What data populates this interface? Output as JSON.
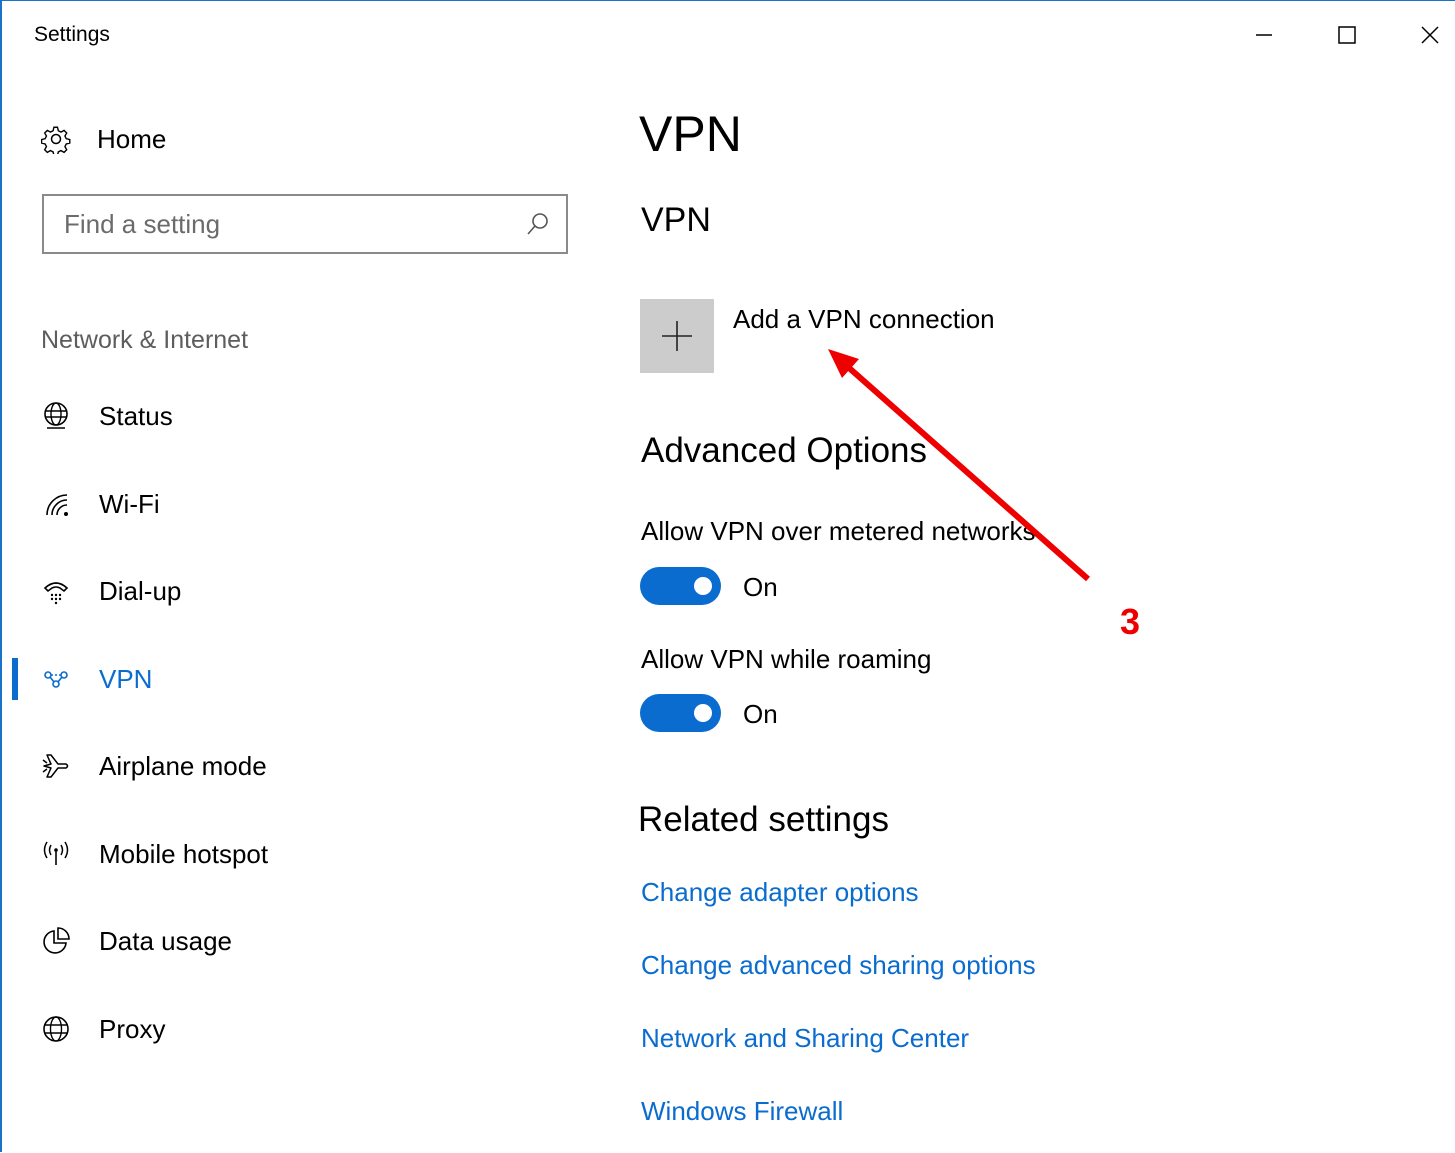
{
  "window": {
    "title": "Settings",
    "controls": [
      "minimize",
      "maximize",
      "close"
    ]
  },
  "sidebar": {
    "home_label": "Home",
    "search": {
      "placeholder": "Find a setting",
      "value": ""
    },
    "section_label": "Network & Internet",
    "items": [
      {
        "label": "Status",
        "icon": "globe-status-icon",
        "active": false
      },
      {
        "label": "Wi-Fi",
        "icon": "wifi-icon",
        "active": false
      },
      {
        "label": "Dial-up",
        "icon": "dialup-phone-icon",
        "active": false
      },
      {
        "label": "VPN",
        "icon": "vpn-icon",
        "active": true
      },
      {
        "label": "Airplane mode",
        "icon": "airplane-icon",
        "active": false
      },
      {
        "label": "Mobile hotspot",
        "icon": "hotspot-icon",
        "active": false
      },
      {
        "label": "Data usage",
        "icon": "pie-chart-icon",
        "active": false
      },
      {
        "label": "Proxy",
        "icon": "globe-icon",
        "active": false
      }
    ]
  },
  "main": {
    "title": "VPN",
    "vpn_heading": "VPN",
    "add_vpn_label": "Add a VPN connection",
    "advanced_heading": "Advanced Options",
    "options": [
      {
        "label": "Allow VPN over metered networks",
        "state": "On",
        "enabled": true
      },
      {
        "label": "Allow VPN while roaming",
        "state": "On",
        "enabled": true
      }
    ],
    "related_heading": "Related settings",
    "links": [
      "Change adapter options",
      "Change advanced sharing options",
      "Network and Sharing Center",
      "Windows Firewall"
    ]
  },
  "annotation": {
    "step_number": "3",
    "color": "#ee0000"
  },
  "colors": {
    "accent": "#0a6ccf",
    "tile": "#cccccc",
    "window_border": "#1a73c9"
  }
}
